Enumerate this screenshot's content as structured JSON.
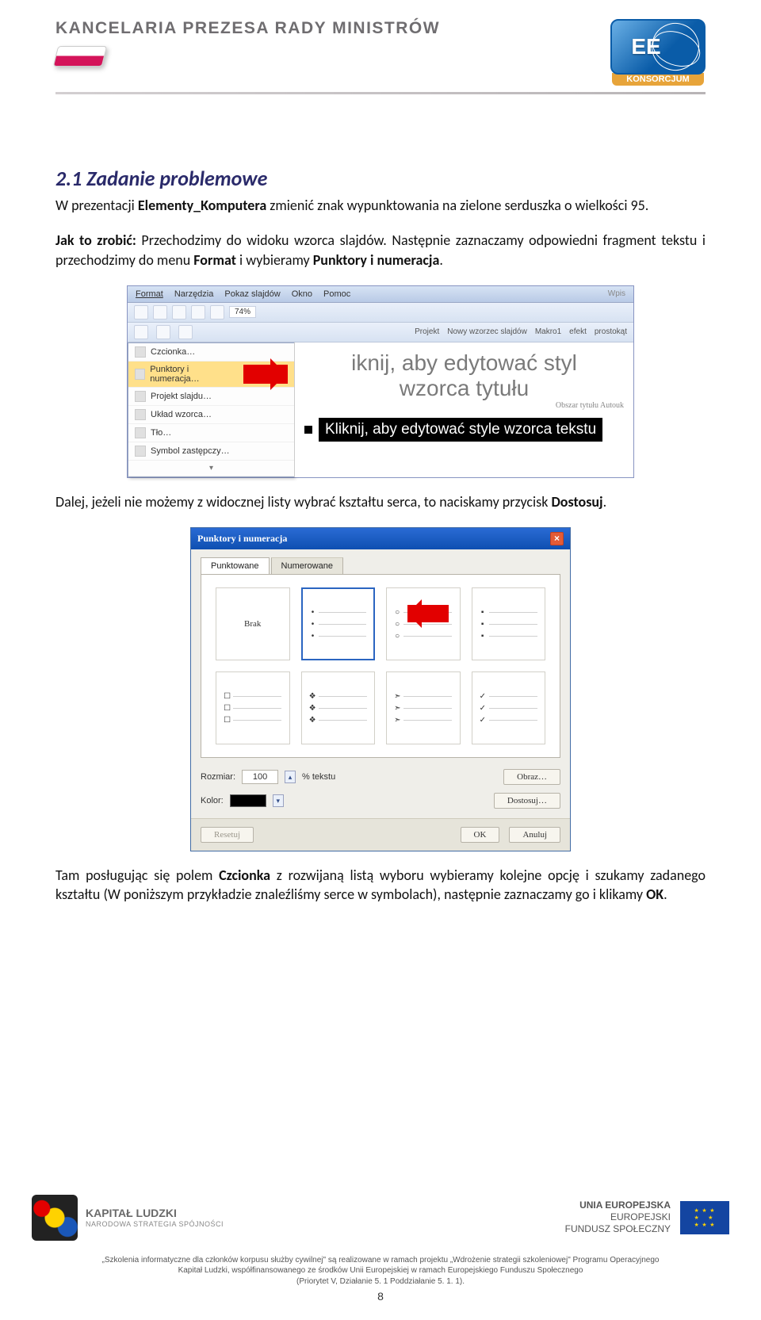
{
  "header": {
    "title": "KANCELARIA PREZESA RADY MINISTRÓW",
    "partner_ee": "EE",
    "partner_sub": "KONSORCJUM"
  },
  "section": {
    "heading": "2.1  Zadanie problemowe",
    "p1a": "W prezentacji ",
    "p1b": "Elementy_Komputera",
    "p1c": " zmienić znak wypunktowania na zielone serduszka o wielkości 95.",
    "p2a": "Jak to zrobić: ",
    "p2b": "Przechodzimy do widoku wzorca slajdów. Następnie zaznaczamy odpowiedni fragment tekstu i przechodzimy do menu ",
    "p2c": "Format",
    "p2d": " i wybieramy ",
    "p2e": "Punktory i numeracja",
    "p2f": ".",
    "p3a": "Dalej, jeżeli nie możemy z widocznej listy wybrać kształtu serca, to naciskamy przycisk ",
    "p3b": "Dostosuj",
    "p3c": "."
  },
  "fig1": {
    "menubar": [
      "Format",
      "Narzędzia",
      "Pokaz slajdów",
      "Okno",
      "Pomoc"
    ],
    "menu_items": [
      "Czcionka…",
      "Punktory i numeracja…",
      "Projekt slajdu…",
      "Układ wzorca…",
      "Tło…",
      "Symbol zastępczy…"
    ],
    "zoom": "74%",
    "tb_right": [
      "Projekt",
      "Nowy wzorzec slajdów",
      "Makro1",
      "efekt",
      "prostokąt"
    ],
    "title_hint_l1": "iknij, aby edytować styl",
    "title_hint_l2": "wzorca tytułu",
    "body_hint": "Kliknij, aby edytować style wzorca tekstu",
    "corner_top": "Wpis",
    "corner_bottom": "Obszar tytułu Autouk"
  },
  "fig2": {
    "title": "Punktory i numeracja",
    "tab1": "Punktowane",
    "tab2": "Numerowane",
    "brak": "Brak",
    "row1": {
      "marks": [
        "•",
        "○",
        "▪"
      ]
    },
    "row2": {
      "marks": [
        "☐",
        "❖",
        "➣",
        "✓"
      ]
    },
    "size_label": "Rozmiar:",
    "size_val": "100",
    "size_suffix": "% tekstu",
    "color_label": "Kolor:",
    "btn_image": "Obraz…",
    "btn_custom": "Dostosuj…",
    "btn_reset": "Resetuj",
    "btn_ok": "OK",
    "btn_cancel": "Anuluj"
  },
  "p4a": "Tam posługując się polem ",
  "p4b": "Czcionka",
  "p4c": " z rozwijaną listą wyboru wybieramy kolejne opcję i szukamy zadanego kształtu (W poniższym przykładzie znaleźliśmy serce w symbolach), następnie zaznaczamy go i klikamy ",
  "p4d": "OK",
  "p4e": ".",
  "footer": {
    "kl_line1": "KAPITAŁ LUDZKI",
    "kl_line2": "NARODOWA STRATEGIA SPÓJNOŚCI",
    "ue_line1": "UNIA EUROPEJSKA",
    "ue_line2": "EUROPEJSKI",
    "ue_line3": "FUNDUSZ SPOŁECZNY",
    "disclaimer_l1": "„Szkolenia informatyczne dla członków korpusu służby cywilnej\" są realizowane w ramach projektu „Wdrożenie strategii szkoleniowej\" Programu Operacyjnego",
    "disclaimer_l2": "Kapitał Ludzki, współfinansowanego ze środków Unii Europejskiej w ramach Europejskiego Funduszu Społecznego",
    "disclaimer_l3": "(Priorytet V, Działanie 5. 1 Poddziałanie 5. 1. 1).",
    "page": "8"
  }
}
